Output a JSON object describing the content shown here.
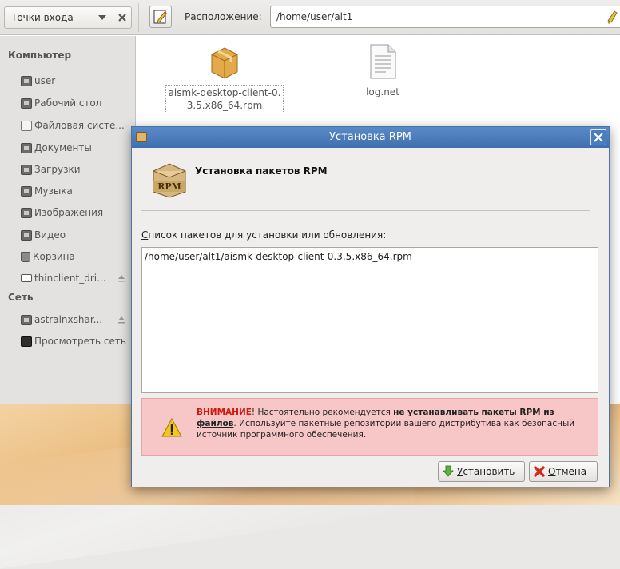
{
  "toolbar": {
    "places_label": "Точки входа",
    "location_label": "Расположение:",
    "location_value": "/home/user/alt1"
  },
  "sidebar": {
    "computer_heading": "Компьютер",
    "computer_items": [
      {
        "label": "user",
        "icon": "home-folder-icon"
      },
      {
        "label": "Рабочий стол",
        "icon": "desktop-folder-icon"
      },
      {
        "label": "Файловая систе...",
        "icon": "filesystem-icon"
      },
      {
        "label": "Документы",
        "icon": "documents-folder-icon"
      },
      {
        "label": "Загрузки",
        "icon": "downloads-folder-icon"
      },
      {
        "label": "Музыка",
        "icon": "music-folder-icon"
      },
      {
        "label": "Изображения",
        "icon": "pictures-folder-icon"
      },
      {
        "label": "Видео",
        "icon": "videos-folder-icon"
      },
      {
        "label": "Корзина",
        "icon": "trash-icon"
      },
      {
        "label": "thinclient_dri...",
        "icon": "drive-icon"
      }
    ],
    "network_heading": "Сеть",
    "network_items": [
      {
        "label": "astralnxshar...",
        "icon": "network-share-icon"
      },
      {
        "label": "Просмотреть сеть",
        "icon": "network-browse-icon"
      }
    ]
  },
  "files": [
    {
      "name_line1": "aismk-desktop-client-0.",
      "name_line2": "3.5.x86_64.rpm",
      "icon": "package-icon"
    },
    {
      "name_line1": "log.net",
      "name_line2": "",
      "icon": "text-file-icon"
    }
  ],
  "dialog": {
    "title": "Установка RPM",
    "heading": "Установка пакетов RPM",
    "list_label_accel": "С",
    "list_label_rest": "писок пакетов для установки или обновления:",
    "packages": [
      "/home/user/alt1/aismk-desktop-client-0.3.5.x86_64.rpm"
    ],
    "warning": {
      "word": "ВНИМАНИЕ",
      "part1": "! Настоятельно рекомендуется ",
      "emph": "не устанавливать пакеты RPM из файлов",
      "part2": ". Используйте пакетные репозитории вашего дистрибутива как безопасный источник программного обеспечения."
    },
    "install_accel": "У",
    "install_rest": "становить",
    "cancel_accel": "О",
    "cancel_rest": "тмена"
  },
  "colors": {
    "titlebar": "#4a7dbd",
    "warning_bg": "#f7c6c7",
    "warning_accent": "#d1170e"
  }
}
